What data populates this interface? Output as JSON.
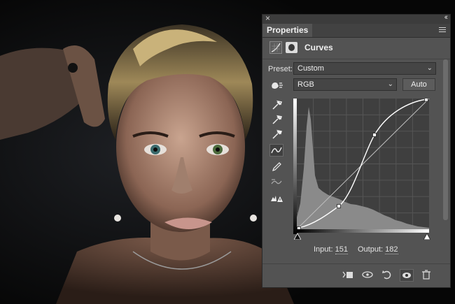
{
  "panel": {
    "title": "Properties",
    "adjustment": "Curves",
    "preset_label": "Preset:",
    "preset_value": "Custom",
    "channel_value": "RGB",
    "auto_label": "Auto",
    "input_label": "Input:",
    "input_value": "151",
    "output_label": "Output:",
    "output_value": "182",
    "close_glyph": "×",
    "collapse_glyph": "‹‹"
  },
  "tools": [
    "hand-icon",
    "black-eyedropper-icon",
    "gray-eyedropper-icon",
    "white-eyedropper-icon",
    "curve-point-icon",
    "pencil-icon",
    "smooth-icon",
    "clipping-warning-icon"
  ],
  "footer_icons": [
    "clip-to-layer-icon",
    "view-previous-icon",
    "reset-icon",
    "visibility-icon",
    "delete-icon"
  ],
  "colors": {
    "panel_bg": "#535353",
    "graph_bg": "#3f3f3f",
    "curve": "#ffffff"
  }
}
